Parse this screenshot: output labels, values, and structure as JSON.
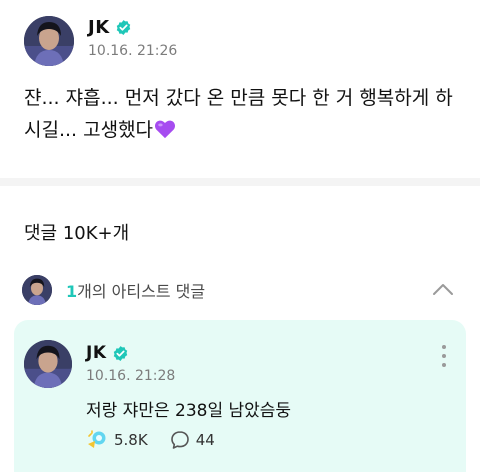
{
  "post": {
    "author": "JK",
    "timestamp": "10.16. 21:26",
    "text": "쟌... 쟈흡... 먼저 갔다 온 만큼 못다 한 거 행복하게 하시길... 고생했다"
  },
  "comments": {
    "count_label": "댓글 10K+개"
  },
  "artist_comments": {
    "count": "1",
    "label": "개의 아티스트 댓글"
  },
  "artist_comment": {
    "author": "JK",
    "timestamp": "10.16. 21:28",
    "text": "저랑 쟈만은 238일 남았슴둥",
    "likes": "5.8K",
    "replies": "44"
  },
  "icons": {
    "verified": "verified-badge-icon",
    "heart": "purple-heart-emoji",
    "chevron": "chevron-up-icon",
    "more": "more-vertical-icon",
    "like": "lightstick-like-icon",
    "reply": "speech-bubble-icon"
  },
  "colors": {
    "accent": "#1fc7b8",
    "card_background": "#e6fbf6",
    "heart": "#a64cf0"
  }
}
